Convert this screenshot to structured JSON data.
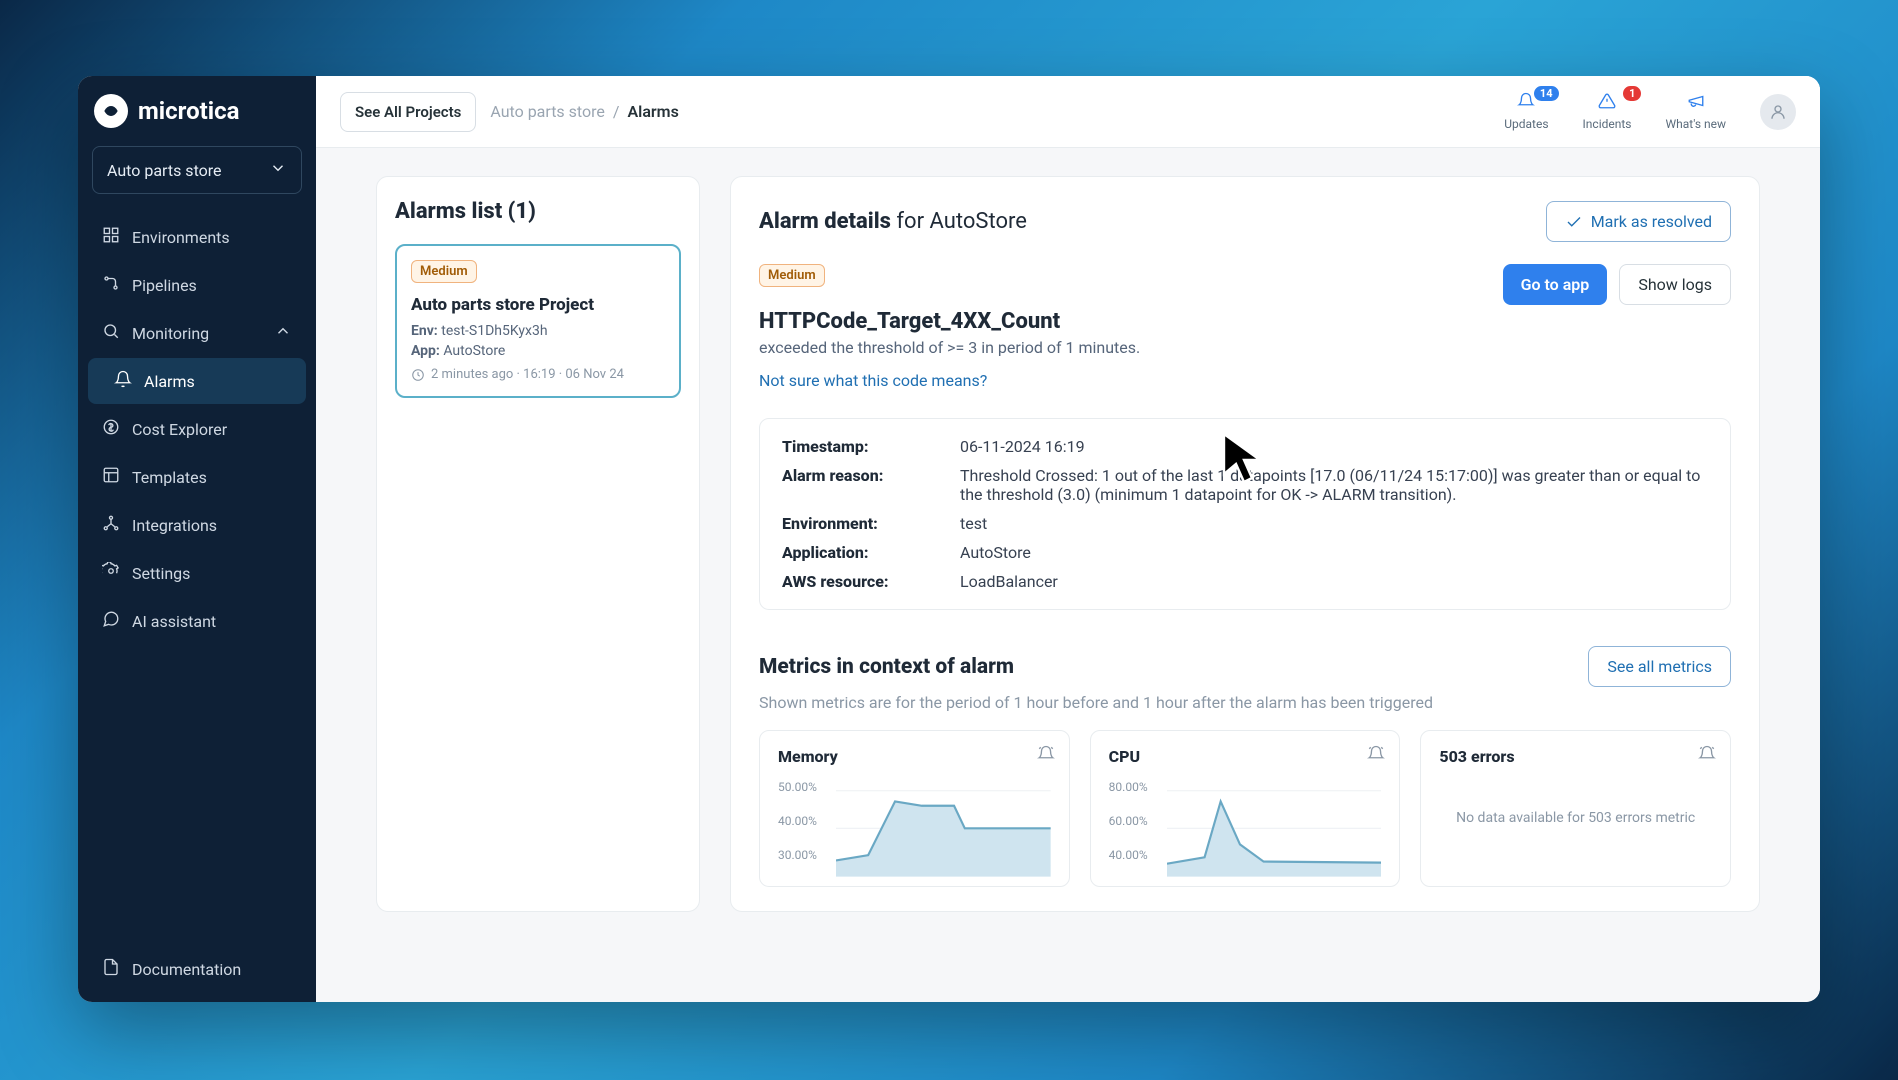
{
  "brand": "microtica",
  "project_select": {
    "label": "Auto parts store"
  },
  "sidebar": {
    "items": [
      {
        "label": "Environments"
      },
      {
        "label": "Pipelines"
      },
      {
        "label": "Monitoring"
      },
      {
        "label": "Alarms"
      },
      {
        "label": "Cost Explorer"
      },
      {
        "label": "Templates"
      },
      {
        "label": "Integrations"
      },
      {
        "label": "Settings"
      },
      {
        "label": "AI assistant"
      }
    ],
    "footer": "Documentation"
  },
  "topbar": {
    "see_all": "See All Projects",
    "crumb_parent": "Auto parts store",
    "crumb_sep": "/",
    "crumb_current": "Alarms",
    "actions": [
      {
        "label": "Updates",
        "count": "14"
      },
      {
        "label": "Incidents",
        "count": "1"
      },
      {
        "label": "What's new"
      }
    ]
  },
  "list": {
    "title": "Alarms list (1)",
    "items": [
      {
        "severity": "Medium",
        "title": "Auto parts store Project",
        "env_label": "Env:",
        "env_value": "test-S1Dh5Kyx3h",
        "app_label": "App:",
        "app_value": "AutoStore",
        "time": "2 minutes ago · 16:19 · 06 Nov 24"
      }
    ]
  },
  "details": {
    "title_bold": "Alarm details",
    "title_rest": " for AutoStore",
    "resolve": "Mark as resolved",
    "go_to_app": "Go to app",
    "show_logs": "Show logs",
    "severity": "Medium",
    "name": "HTTPCode_Target_4XX_Count",
    "desc": "exceeded the threshold of >= 3 in period of 1 minutes.",
    "help_link": "Not sure what this code means?",
    "kv": [
      {
        "k": "Timestamp:",
        "v": "06-11-2024 16:19"
      },
      {
        "k": "Alarm reason:",
        "v": "Threshold Crossed: 1 out of the last 1 datapoints [17.0 (06/11/24 15:17:00)] was greater than or equal to the threshold (3.0) (minimum 1 datapoint for OK -> ALARM transition)."
      },
      {
        "k": "Environment:",
        "v": "test"
      },
      {
        "k": "Application:",
        "v": "AutoStore"
      },
      {
        "k": "AWS resource:",
        "v": "LoadBalancer"
      }
    ]
  },
  "metrics": {
    "title": "Metrics in context of alarm",
    "sub": "Shown metrics are for the period of 1 hour before and 1 hour after the alarm has been triggered",
    "see_all": "See all metrics",
    "cards": [
      {
        "title": "Memory",
        "yticks": [
          "50.00%",
          "40.00%",
          "30.00%"
        ],
        "has_data": true
      },
      {
        "title": "CPU",
        "yticks": [
          "80.00%",
          "60.00%",
          "40.00%"
        ],
        "has_data": true
      },
      {
        "title": "503 errors",
        "has_data": false,
        "no_data": "No data available for 503 errors metric"
      }
    ]
  },
  "chart_data": [
    {
      "type": "area",
      "title": "Memory",
      "ylim": [
        30,
        50
      ],
      "x": [
        0,
        1,
        2,
        3,
        4,
        5,
        6,
        7,
        8,
        9
      ],
      "values": [
        32,
        33,
        45,
        44,
        44,
        40,
        40,
        40,
        40,
        40
      ]
    },
    {
      "type": "area",
      "title": "CPU",
      "ylim": [
        40,
        80
      ],
      "x": [
        0,
        1,
        2,
        3,
        4,
        5,
        6,
        7,
        8,
        9
      ],
      "values": [
        42,
        45,
        72,
        50,
        44,
        43,
        43,
        43,
        43,
        43
      ]
    },
    {
      "type": "area",
      "title": "503 errors",
      "no_data": true
    }
  ]
}
